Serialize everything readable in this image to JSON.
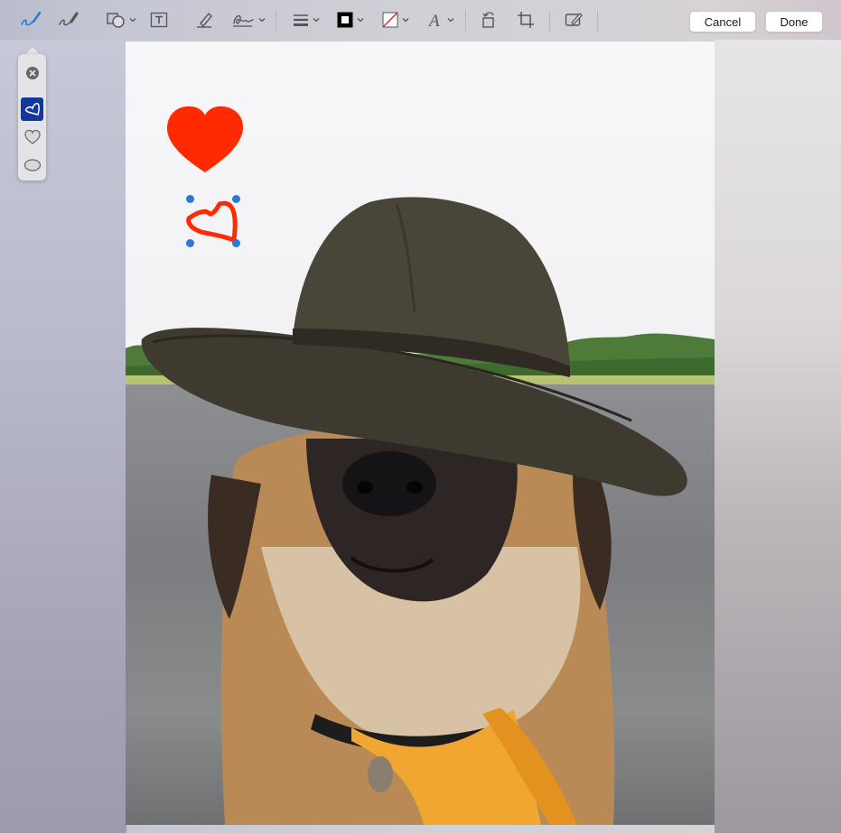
{
  "toolbar": {
    "tools": [
      {
        "id": "sketch",
        "icon": "sketch-pen-icon",
        "active": true
      },
      {
        "id": "draw",
        "icon": "draw-brush-icon"
      },
      {
        "id": "shapes",
        "icon": "shapes-icon"
      },
      {
        "id": "text",
        "icon": "text-box-icon"
      },
      {
        "id": "highlight",
        "icon": "highlight-pen-icon"
      },
      {
        "id": "sign",
        "icon": "signature-icon"
      },
      {
        "id": "shape_style",
        "icon": "line-weight-icon"
      },
      {
        "id": "border_color",
        "icon": "border-color-icon",
        "color": "#000000"
      },
      {
        "id": "fill_color",
        "icon": "fill-color-icon"
      },
      {
        "id": "text_style",
        "icon": "text-style-icon"
      },
      {
        "id": "rotate",
        "icon": "rotate-icon"
      },
      {
        "id": "crop",
        "icon": "crop-icon"
      },
      {
        "id": "annotate",
        "icon": "annotate-icon"
      }
    ],
    "cancel_label": "Cancel",
    "done_label": "Done"
  },
  "shape_palette": {
    "items": [
      {
        "id": "revert",
        "icon": "close-circle-icon"
      },
      {
        "id": "sketched",
        "icon": "sketched-heart-icon",
        "selected": true
      },
      {
        "id": "heart",
        "icon": "heart-outline-icon"
      },
      {
        "id": "oval",
        "icon": "ellipse-icon"
      }
    ]
  },
  "colors": {
    "accent": "#2a79d4",
    "selected_bg": "#13379d",
    "annotation": "#ff2a00"
  }
}
